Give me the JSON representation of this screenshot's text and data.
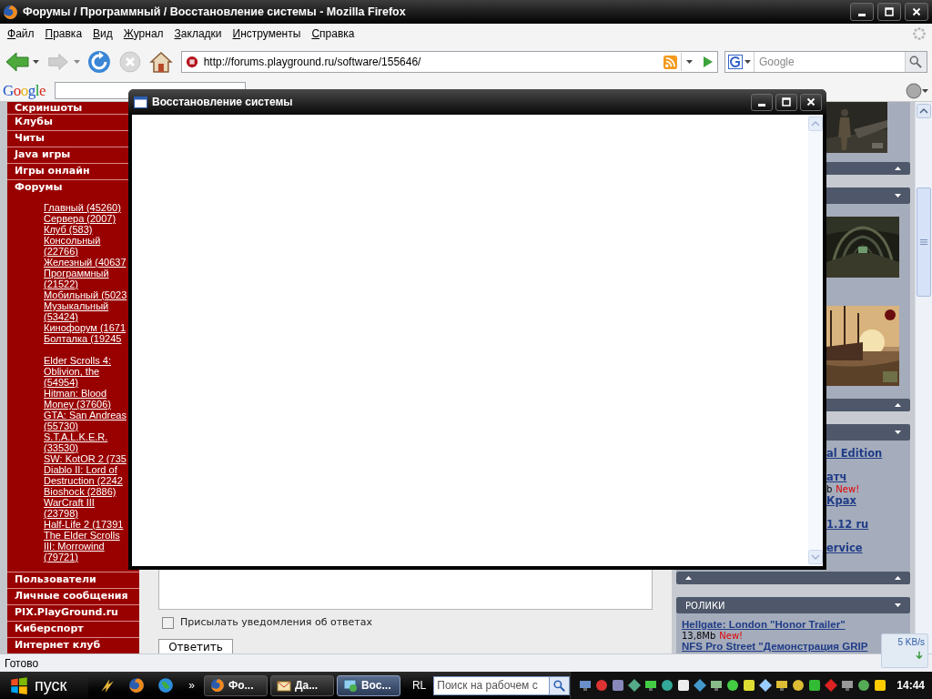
{
  "window": {
    "title": "Форумы / Программный / Восстановление системы - Mozilla Firefox"
  },
  "menu": [
    "Файл",
    "Правка",
    "Вид",
    "Журнал",
    "Закладки",
    "Инструменты",
    "Справка"
  ],
  "address": {
    "value": "http://forums.playground.ru/software/155646/"
  },
  "search": {
    "placeholder": "Google"
  },
  "google_toolbar": {
    "logo": "Google"
  },
  "sidebar": {
    "top_items": [
      "Скриншоты",
      "Клубы",
      "Читы",
      "Java игры",
      "Игры онлайн"
    ],
    "section": "Форумы",
    "link_groups": [
      {
        "links": [
          "Главный (45260)",
          "Сервера (2007)",
          "Клуб (583)",
          "Консольный (22766)",
          "Железный (40637",
          "Программный (21522)",
          "Мобильный (5023",
          "Музыкальный (53424)",
          "Кинофорум (1671",
          "Болталка (19245"
        ]
      },
      {
        "links": [
          "Elder Scrolls 4: Oblivion, the (54954)",
          "Hitman: Blood Money (37606)",
          "GTA: San Andreas (55730)",
          "S.T.A.L.K.E.R. (33530)",
          "SW: KotOR 2 (735",
          "Diablo II: Lord of Destruction (2242",
          "Bioshock (2886)",
          "WarCraft III (23798)",
          "Half-Life 2 (17391",
          "The Elder Scrolls III: Morrowind (79721)"
        ]
      }
    ],
    "bottom_items": [
      "Пользователи",
      "Личные сообщения",
      "PIX.PlayGround.ru",
      "Киберспорт",
      "Интернет клуб"
    ]
  },
  "dialog": {
    "title": "Восстановление системы"
  },
  "reply": {
    "notify_label": "Присылать уведомления об ответах",
    "notify_checked": false,
    "submit": "Ответить"
  },
  "right_column": {
    "news": [
      {
        "title": "al Edition"
      },
      {
        "title": "атч",
        "meta": "b",
        "new": "New!"
      },
      {
        "title": "Крах"
      },
      {
        "title": "1.12 ru"
      },
      {
        "title": "ervice"
      }
    ],
    "videos": {
      "title": "РОЛИКИ",
      "items": [
        {
          "title": "Hellgate: London \"Honor Trailer\"",
          "meta": "13,8Mb",
          "new": "New!"
        },
        {
          "title": "NFS Pro Street \"Демонстрация GRIP"
        }
      ]
    }
  },
  "download": {
    "speed": "5 KB/s"
  },
  "status_bar": {
    "text": "Готово"
  },
  "taskbar": {
    "start": "пуск",
    "more": "»",
    "tasks": [
      {
        "label": "Фо...",
        "kind": "browser",
        "selected": false
      },
      {
        "label": "Да...",
        "kind": "mail",
        "selected": false
      },
      {
        "label": "Вос...",
        "kind": "restore",
        "selected": true
      }
    ],
    "lang": "RL",
    "search": {
      "placeholder": "Поиск на рабочем с"
    },
    "clock": "14:44"
  }
}
